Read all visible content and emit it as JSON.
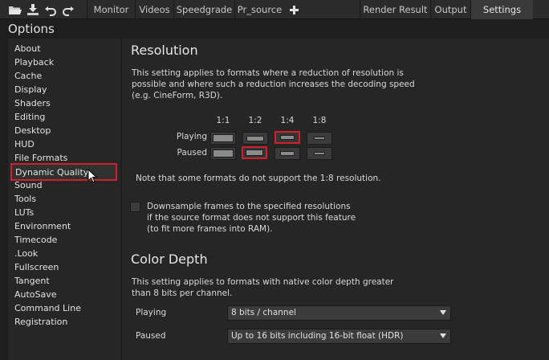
{
  "toolbar": {
    "icons": [
      "folder-open-icon",
      "download-icon",
      "undo-icon",
      "redo-icon"
    ],
    "tabs": [
      {
        "label": "Monitor",
        "active": false
      },
      {
        "label": "Videos",
        "active": false
      },
      {
        "label": "Speedgrade",
        "active": false
      },
      {
        "label": "Pr_source",
        "active": false
      },
      {
        "label": "Render Result",
        "active": false
      },
      {
        "label": "Output",
        "active": false
      },
      {
        "label": "Settings",
        "active": true
      }
    ],
    "add_tab_icon": "plus-icon"
  },
  "sidebar": {
    "title": "Options",
    "items": [
      {
        "label": "About"
      },
      {
        "label": "Playback"
      },
      {
        "label": "Cache"
      },
      {
        "label": "Display"
      },
      {
        "label": "Shaders"
      },
      {
        "label": "Editing"
      },
      {
        "label": "Desktop"
      },
      {
        "label": "HUD"
      },
      {
        "label": "File Formats"
      },
      {
        "label": "Dynamic Quality",
        "selected": true
      },
      {
        "label": "Sound"
      },
      {
        "label": "Tools"
      },
      {
        "label": "LUTs"
      },
      {
        "label": "Environment"
      },
      {
        "label": "Timecode"
      },
      {
        "label": ".Look"
      },
      {
        "label": "Fullscreen"
      },
      {
        "label": "Tangent"
      },
      {
        "label": "AutoSave"
      },
      {
        "label": "Command Line"
      },
      {
        "label": "Registration"
      }
    ]
  },
  "resolution": {
    "title": "Resolution",
    "description": [
      "This setting applies to formats where a reduction of resolution is",
      "possible and where such a reduction increases the decoding speed",
      "(e.g. CineForm, R3D)."
    ],
    "columns": [
      "1:1",
      "1:2",
      "1:4",
      "1:8"
    ],
    "rows": [
      {
        "label": "Playing",
        "selected_index": 2
      },
      {
        "label": "Paused",
        "selected_index": 1
      }
    ],
    "note": "Note that some formats do not support the 1:8 resolution.",
    "downsample": {
      "checked": false,
      "lines": [
        "Downsample frames to the specified resolutions",
        "if the source format does not support this feature",
        "(to fit more frames into RAM)."
      ]
    }
  },
  "color_depth": {
    "title": "Color Depth",
    "description": [
      "This setting applies to formats with native color depth greater",
      "than 8 bits per channel."
    ],
    "playing": {
      "label": "Playing",
      "value": "8 bits / channel"
    },
    "paused": {
      "label": "Paused",
      "value": "Up to 16 bits including 16-bit float (HDR)"
    }
  },
  "colors": {
    "accent_red": "#d0202c"
  }
}
